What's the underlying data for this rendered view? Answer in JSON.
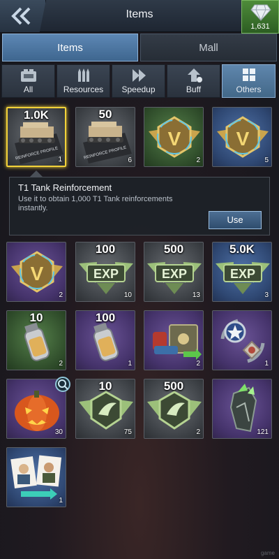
{
  "header": {
    "title": "Items",
    "back_icon": "double-chevron-left-icon",
    "gem_icon": "diamond-icon",
    "gem_count": "1,631"
  },
  "main_tabs": {
    "items": "Items",
    "mall": "Mall"
  },
  "category_tabs": [
    {
      "label": "All",
      "icon": "box-icon"
    },
    {
      "label": "Resources",
      "icon": "ammo-icon"
    },
    {
      "label": "Speedup",
      "icon": "fast-forward-icon"
    },
    {
      "label": "Buff",
      "icon": "upgrade-arrow-icon"
    },
    {
      "label": "Others",
      "icon": "grid-icon"
    }
  ],
  "items": [
    {
      "top": "1.0K",
      "qty": "1",
      "art": "tank",
      "bg": "gray",
      "selected": true
    },
    {
      "top": "50",
      "qty": "6",
      "art": "tank",
      "bg": "gray"
    },
    {
      "top": "",
      "qty": "2",
      "art": "vip",
      "bg": "green"
    },
    {
      "top": "",
      "qty": "5",
      "art": "vip",
      "bg": "blue"
    },
    {
      "top": "",
      "qty": "2",
      "art": "vip",
      "bg": "purple"
    },
    {
      "top": "100",
      "qty": "10",
      "art": "exp",
      "bg": "gray"
    },
    {
      "top": "500",
      "qty": "13",
      "art": "exp",
      "bg": "gray"
    },
    {
      "top": "5.0K",
      "qty": "3",
      "art": "exp",
      "bg": "blue"
    },
    {
      "top": "10",
      "qty": "2",
      "art": "grenade",
      "bg": "green"
    },
    {
      "top": "100",
      "qty": "1",
      "art": "grenade",
      "bg": "purple"
    },
    {
      "top": "",
      "qty": "2",
      "art": "supply",
      "bg": "purple"
    },
    {
      "top": "",
      "qty": "1",
      "art": "medal",
      "bg": "purple"
    },
    {
      "top": "",
      "qty": "30",
      "art": "pumpkin",
      "bg": "purple"
    },
    {
      "top": "10",
      "qty": "75",
      "art": "wings",
      "bg": "gray"
    },
    {
      "top": "500",
      "qty": "2",
      "art": "wings",
      "bg": "gray"
    },
    {
      "top": "",
      "qty": "121",
      "art": "crystal",
      "bg": "purple"
    },
    {
      "top": "",
      "qty": "1",
      "art": "portraits",
      "bg": "blue"
    }
  ],
  "tooltip": {
    "title": "T1 Tank Reinforcement",
    "description": "Use it to obtain 1,000 T1 Tank reinforcements instantly.",
    "use_label": "Use"
  },
  "tank_card_text": "REINFORCE PROFILE",
  "watermark": "game"
}
